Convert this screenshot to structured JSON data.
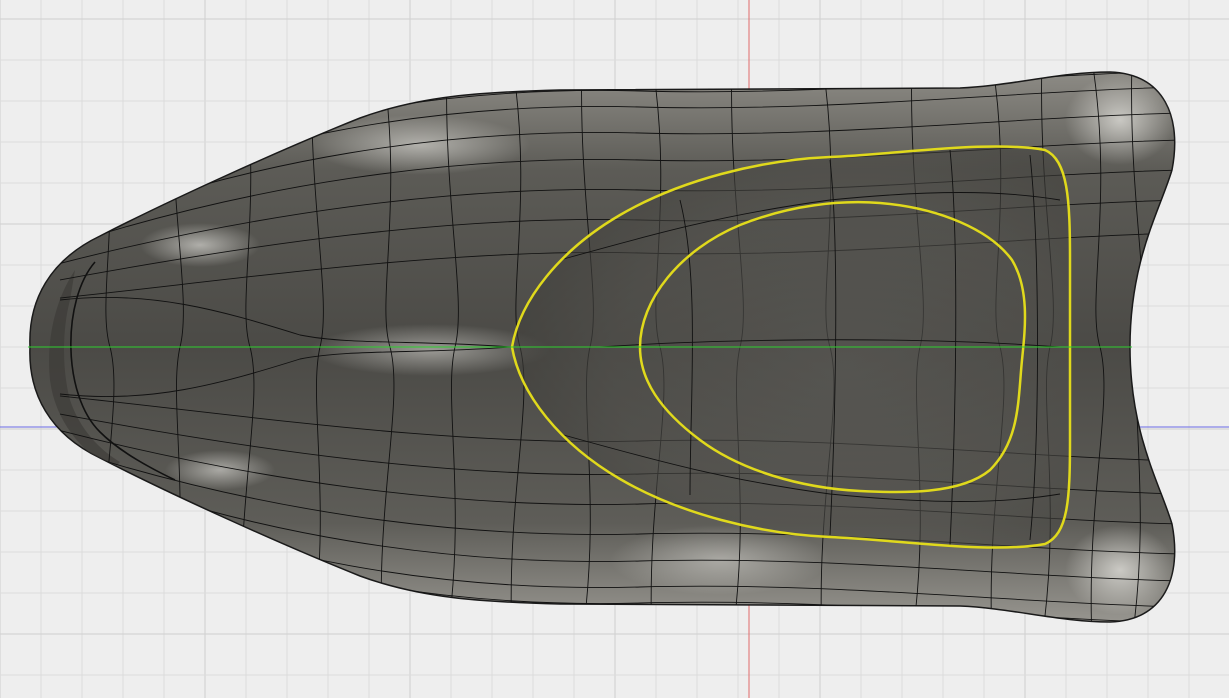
{
  "viewport": {
    "background": "#eeeeee",
    "grid_minor_color": "#dcdcdc",
    "grid_major_color": "#cfcfcf",
    "axis_x_color": "#2fcf2f",
    "axis_y_color": "#e06a6a",
    "axis_z_color": "#6a6ae6"
  },
  "model": {
    "name": "t-spline-seat-body",
    "body_color": "#5a5954",
    "highlight_color": "#f2f1ec",
    "mesh_line_color": "#111111",
    "selected_edge_color": "#e0d91c",
    "selected_edges": [
      "outer-recess-loop",
      "inner-recess-loop"
    ]
  }
}
